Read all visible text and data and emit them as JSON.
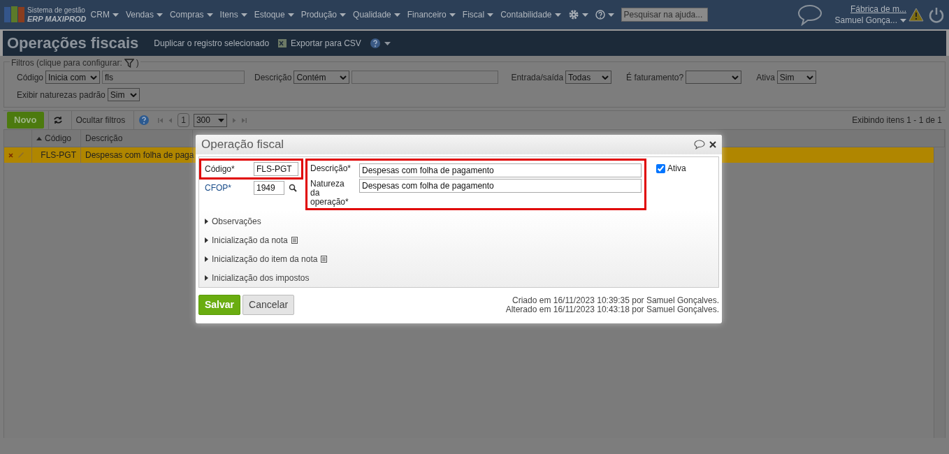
{
  "header": {
    "logo_line1": "Sistema de gestão",
    "logo_line2": "ERP MAXIPROD",
    "menus": [
      "CRM",
      "Vendas",
      "Compras",
      "Itens",
      "Estoque",
      "Produção",
      "Qualidade",
      "Financeiro",
      "Fiscal",
      "Contabilidade"
    ],
    "search": {
      "placeholder": "Pesquisar na ajuda..."
    },
    "company": "Fábrica de m...",
    "user": "Samuel Gonça..."
  },
  "page": {
    "title": "Operações fiscais",
    "actions": [
      "Duplicar o registro selecionado",
      "Exportar para CSV"
    ]
  },
  "filters": {
    "legend": "Filtros (clique para configurar:",
    "legend_end": ")",
    "fields": [
      {
        "label": "Código",
        "controls": [
          {
            "kind": "select",
            "value": "Inicia com"
          },
          {
            "kind": "text",
            "value": "fls"
          }
        ]
      },
      {
        "label": "Descrição",
        "controls": [
          {
            "kind": "select",
            "value": "Contém"
          },
          {
            "kind": "text"
          }
        ]
      },
      {
        "label": "Entrada/saída",
        "controls": [
          {
            "kind": "select",
            "value": "Todas"
          }
        ]
      },
      {
        "label": "É faturamento?",
        "controls": [
          {
            "kind": "select"
          }
        ]
      },
      {
        "label": "Ativa",
        "controls": [
          {
            "kind": "select",
            "value": "Sim"
          }
        ]
      },
      {
        "label": "Exibir naturezas padrão",
        "controls": [
          {
            "kind": "select",
            "value": "Sim"
          }
        ]
      }
    ]
  },
  "toolbar": {
    "new_button": "Novo",
    "hide_filters": "Ocultar filtros",
    "page": "1",
    "page_size": "300",
    "status": "Exibindo itens 1 - 1 de 1"
  },
  "table": {
    "columns": [
      {
        "label": "Código",
        "sorted": true
      },
      {
        "label": "Descrição",
        "sorted": false
      }
    ],
    "rows": [
      {
        "cells": [
          "FLS-PGT",
          "Despesas com folha de paga"
        ],
        "selected": true
      }
    ]
  },
  "dialog": {
    "title": "Operação fiscal",
    "code": {
      "label": "Código*",
      "value": "FLS-PGT"
    },
    "cfop": {
      "label": "CFOP*",
      "value": "1949"
    },
    "description": {
      "label": "Descrição*",
      "value": "Despesas com folha de pagamento"
    },
    "nature": {
      "label": "Natureza da operação*",
      "value": "Despesas com folha de pagamento"
    },
    "active": {
      "label": "Ativa",
      "checked": true
    },
    "sections": [
      {
        "label": "Observações",
        "expanded": false,
        "note_icon": false
      },
      {
        "label": "Inicialização da nota",
        "expanded": false,
        "note_icon": true
      },
      {
        "label": "Inicialização do item da nota",
        "expanded": false,
        "note_icon": true
      },
      {
        "label": "Inicialização dos impostos",
        "expanded": false,
        "note_icon": false
      }
    ],
    "buttons": [
      {
        "label": "Salvar",
        "kind": "primary"
      },
      {
        "label": "Cancelar",
        "kind": "secondary"
      }
    ],
    "audit": [
      "Criado em 16/11/2023 10:39:35 por Samuel Gonçalves.",
      "Alterado em 16/11/2023 10:43:18 por Samuel Gonçalves."
    ]
  }
}
